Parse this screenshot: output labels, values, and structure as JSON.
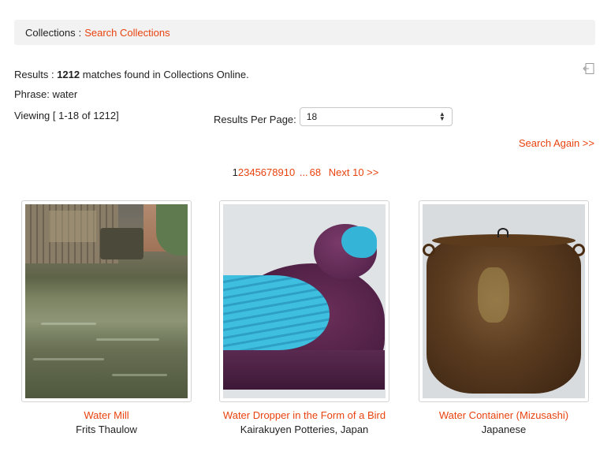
{
  "breadcrumb": {
    "root": "Collections",
    "separator": ":",
    "current": "Search Collections"
  },
  "results": {
    "prefix": "Results :",
    "count": "1212",
    "suffix": "matches found in Collections Online."
  },
  "phrase": {
    "label": "Phrase:",
    "value": "water"
  },
  "viewing": "Viewing [ 1-18 of 1212]",
  "results_per_page": {
    "label": "Results Per Page:",
    "value": "18"
  },
  "search_again": "Search Again >>",
  "pagination": {
    "current": "1",
    "pages": [
      "2",
      "3",
      "4",
      "5",
      "6",
      "7",
      "8",
      "9",
      "10"
    ],
    "ellipsis": "...",
    "last": "68",
    "next": "Next 10 >>"
  },
  "items": [
    {
      "title": "Water Mill",
      "artist": "Frits Thaulow"
    },
    {
      "title": "Water Dropper in the Form of a Bird",
      "artist": "Kairakuyen Potteries, Japan"
    },
    {
      "title": "Water Container (Mizusashi)",
      "artist": "Japanese"
    }
  ],
  "colors": {
    "accent": "#e8430f",
    "breadcrumb_bg": "#f2f2f2",
    "border": "#d3d3d3"
  },
  "icons": {
    "export": "export-icon",
    "select_arrows": "select-arrows-icon"
  }
}
